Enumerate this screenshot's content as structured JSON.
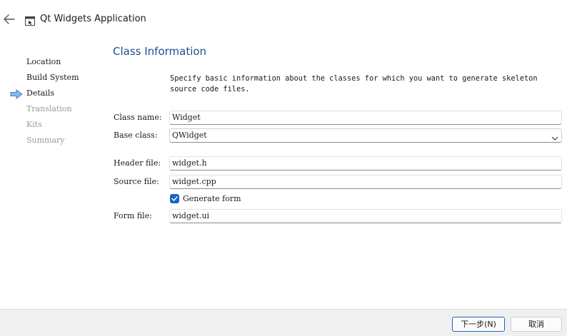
{
  "window": {
    "title": "Qt Widgets Application"
  },
  "icons": {
    "back": "back-arrow-icon",
    "app": "window-icon",
    "current_step": "right-arrow-icon",
    "combo": "chevron-down-icon",
    "check": "check-icon"
  },
  "steps": [
    {
      "label": "Location",
      "state": "done"
    },
    {
      "label": "Build System",
      "state": "done"
    },
    {
      "label": "Details",
      "state": "current"
    },
    {
      "label": "Translation",
      "state": "pending"
    },
    {
      "label": "Kits",
      "state": "pending"
    },
    {
      "label": "Summary",
      "state": "pending"
    }
  ],
  "page": {
    "title": "Class Information",
    "description": "Specify basic information about the classes for which you want to generate skeleton source code files."
  },
  "form": {
    "class_name": {
      "label": "Class name:",
      "value": "Widget"
    },
    "base_class": {
      "label": "Base class:",
      "value": "QWidget"
    },
    "header_file": {
      "label": "Header file:",
      "value": "widget.h"
    },
    "source_file": {
      "label": "Source file:",
      "value": "widget.cpp"
    },
    "generate_form": {
      "label": "Generate form",
      "checked": true
    },
    "form_file": {
      "label": "Form file:",
      "value": "widget.ui"
    }
  },
  "buttons": {
    "next": "下一步(N)",
    "cancel": "取消"
  },
  "colors": {
    "accent": "#1666c7",
    "title": "#1d4f91",
    "pending_text": "#9a9a9a",
    "footer_bg": "#f0f0f0",
    "step_arrow": "#4a90d9"
  }
}
